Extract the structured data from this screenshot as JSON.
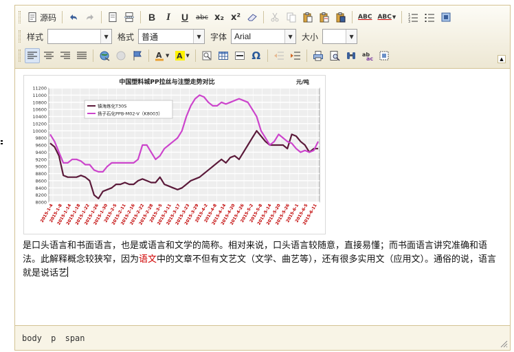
{
  "toolbar": {
    "source_label": "源码",
    "bold_label": "B",
    "italic_label": "I",
    "underline_label": "U",
    "strike_label": "abc",
    "sub_label": "x₂",
    "sup_label": "x²",
    "spell_label": "ABC",
    "spell2_label": "ABC",
    "style_label": "样式",
    "style_value": "",
    "format_label": "格式",
    "format_value": "普通",
    "font_label": "字体",
    "font_value": "Arial",
    "size_label": "大小",
    "size_value": "",
    "omega_label": "Ω"
  },
  "chart_data": {
    "type": "line",
    "title": "中国塑料城PP拉丝与注塑走势对比",
    "unit": "元/吨",
    "ylim": [
      8000,
      11200
    ],
    "yticks": [
      8000,
      8200,
      8400,
      8600,
      8800,
      9000,
      9200,
      9400,
      9600,
      9800,
      10000,
      10200,
      10400,
      10600,
      10800,
      11000,
      11200
    ],
    "xtick_labels": [
      "2015-1-4",
      "2015-1-8",
      "2015-1-14",
      "2015-1-18",
      "2015-1-22",
      "2015-1-26",
      "2015-1-30",
      "2015-2-5",
      "2015-2-11",
      "2015-2-16",
      "2015-2-22",
      "2015-2-28",
      "2015-3-5",
      "2015-3-11",
      "2015-3-17",
      "2015-3-23",
      "2015-3-29",
      "2015-4-2",
      "2015-4-8",
      "2015-4-14",
      "2015-4-20",
      "2015-4-26",
      "2015-5-2",
      "2015-5-8",
      "2015-5-14",
      "2015-5-20",
      "2015-5-26",
      "2015-6-1",
      "2015-6-5",
      "2015-6-11"
    ],
    "grid": true,
    "legend_position": "top-left",
    "series": [
      {
        "name": "镇海炼化T30S",
        "color": "#5b1a3a",
        "values": [
          9650,
          9550,
          9300,
          8750,
          8700,
          8700,
          8700,
          8750,
          8700,
          8600,
          8200,
          8100,
          8300,
          8350,
          8400,
          8500,
          8500,
          8550,
          8500,
          8500,
          8600,
          8650,
          8600,
          8550,
          8550,
          8700,
          8500,
          8450,
          8400,
          8350,
          8400,
          8500,
          8600,
          8650,
          8700,
          8800,
          8900,
          9000,
          9100,
          9200,
          9100,
          9250,
          9300,
          9200,
          9400,
          9600,
          9800,
          10000,
          9850,
          9700,
          9600,
          9600,
          9600,
          9600,
          9500,
          9900,
          9850,
          9700,
          9600,
          9400,
          9500,
          9500
        ]
      },
      {
        "name": "扬子石化PPB-M02-V（K8003）",
        "color": "#cc44cc",
        "values": [
          9900,
          9700,
          9400,
          9100,
          9100,
          9200,
          9200,
          9150,
          9050,
          9050,
          8900,
          8850,
          8850,
          9000,
          9100,
          9100,
          9100,
          9100,
          9100,
          9100,
          9200,
          9600,
          9600,
          9400,
          9200,
          9300,
          9500,
          9600,
          9700,
          9800,
          10000,
          10400,
          10700,
          10900,
          11000,
          10950,
          10800,
          10700,
          10700,
          10800,
          10750,
          10800,
          10850,
          10900,
          10850,
          10800,
          10600,
          10400,
          10000,
          9800,
          9600,
          9700,
          9900,
          9800,
          9700,
          9650,
          9500,
          9400,
          9450,
          9400,
          9450,
          9700
        ]
      }
    ]
  },
  "content": {
    "para_1": "是口头语言和书面语言，也是或语言和文学的简称。相对来说，口头语言较随意，直接易懂；而书面语言讲究准确和语法。此解释概念较狭窄，因为",
    "link_text": "语文",
    "para_2": "中的文章不但有文艺文（文学、曲艺等），还有很多实用文（应用文）。通俗的说，语言就是说话艺"
  },
  "status": {
    "path_body": "body",
    "path_p": "p",
    "path_span": "span"
  }
}
